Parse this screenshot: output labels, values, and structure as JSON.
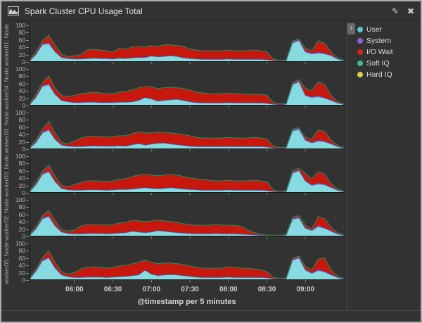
{
  "panel": {
    "title": "Spark Cluster CPU Usage Total",
    "edit_icon": "✎",
    "close_icon": "✖"
  },
  "legend": {
    "collapse_icon": "›",
    "items": [
      {
        "label": "User",
        "color": "#57c8d2"
      },
      {
        "label": "System",
        "color": "#8a63d2"
      },
      {
        "label": "I/O Wait",
        "color": "#d2251a"
      },
      {
        "label": "Soft IQ",
        "color": "#3cbf85"
      },
      {
        "label": "Hard IQ",
        "color": "#d6d33f"
      }
    ]
  },
  "axes": {
    "y_ticks": [
      100,
      80,
      60,
      40,
      20,
      0
    ],
    "x_ticks": [
      "06:00",
      "06:30",
      "07:00",
      "07:30",
      "08:00",
      "08:30",
      "09:00"
    ],
    "x_title": "@timestamp per 5 minutes"
  },
  "chart_data": {
    "type": "area",
    "stacked": true,
    "y_range": [
      0,
      100
    ],
    "grid": false,
    "legend_position": "right",
    "series_order": [
      "User",
      "System",
      "I/O Wait",
      "Soft IQ",
      "Hard IQ"
    ],
    "series_styles": {
      "User": {
        "fill": "#86dbe1",
        "stroke": "#2fa3ad"
      },
      "System": {
        "fill": "#8a5bd6",
        "stroke": "#6236b8"
      },
      "I/O Wait": {
        "fill": "#c8180e",
        "stroke": "#871410"
      },
      "Soft IQ": {
        "fill": "#3cb879",
        "stroke": "#2c8f5e"
      },
      "Hard IQ": {
        "fill": "#d6d33f",
        "stroke": "#a8a52e"
      }
    },
    "x": [
      "05:25",
      "05:30",
      "05:35",
      "05:40",
      "05:45",
      "05:50",
      "05:55",
      "06:00",
      "06:05",
      "06:10",
      "06:15",
      "06:20",
      "06:25",
      "06:30",
      "06:35",
      "06:40",
      "06:45",
      "06:50",
      "06:55",
      "07:00",
      "07:05",
      "07:10",
      "07:15",
      "07:20",
      "07:25",
      "07:30",
      "07:35",
      "07:40",
      "07:45",
      "07:50",
      "07:55",
      "08:00",
      "08:05",
      "08:10",
      "08:15",
      "08:20",
      "08:25",
      "08:30",
      "08:35",
      "08:40",
      "08:45",
      "08:50",
      "08:55",
      "09:00",
      "09:05",
      "09:10",
      "09:15",
      "09:20",
      "09:25",
      "09:30"
    ],
    "panels": [
      {
        "label": "worker01: Node",
        "series": {
          "User": [
            1,
            18,
            45,
            48,
            25,
            10,
            7,
            6,
            6,
            7,
            8,
            7,
            7,
            6,
            8,
            7,
            9,
            10,
            10,
            14,
            12,
            13,
            15,
            13,
            9,
            7,
            6,
            5,
            5,
            5,
            5,
            6,
            5,
            5,
            5,
            5,
            5,
            4,
            2,
            1,
            2,
            50,
            56,
            25,
            20,
            22,
            20,
            15,
            6,
            1
          ],
          "System": [
            0,
            2,
            3,
            3,
            2,
            1,
            1,
            1,
            1,
            1,
            1,
            1,
            1,
            1,
            1,
            1,
            1,
            1,
            1,
            1,
            1,
            1,
            1,
            1,
            1,
            1,
            1,
            1,
            1,
            1,
            1,
            1,
            1,
            1,
            1,
            1,
            1,
            1,
            0,
            0,
            0,
            2,
            3,
            2,
            2,
            3,
            2,
            2,
            1,
            0
          ],
          "I/O Wait": [
            1,
            5,
            7,
            19,
            15,
            7,
            4,
            7,
            11,
            22,
            23,
            22,
            20,
            18,
            26,
            24,
            28,
            29,
            27,
            27,
            27,
            30,
            28,
            28,
            30,
            24,
            23,
            22,
            22,
            22,
            22,
            23,
            22,
            22,
            22,
            24,
            22,
            20,
            3,
            1,
            1,
            3,
            1,
            8,
            6,
            30,
            26,
            8,
            1,
            1
          ],
          "Soft IQ": 0.6,
          "Hard IQ": 0
        }
      },
      {
        "label": "worker04: Node",
        "series": {
          "User": [
            1,
            20,
            50,
            55,
            28,
            12,
            8,
            6,
            6,
            7,
            7,
            6,
            6,
            6,
            7,
            7,
            8,
            12,
            20,
            16,
            10,
            12,
            14,
            15,
            12,
            8,
            6,
            5,
            5,
            5,
            5,
            6,
            5,
            5,
            5,
            5,
            5,
            4,
            2,
            1,
            2,
            55,
            63,
            25,
            20,
            22,
            18,
            12,
            5,
            1
          ],
          "System": [
            0,
            2,
            3,
            3,
            2,
            1,
            1,
            1,
            1,
            1,
            1,
            1,
            1,
            1,
            1,
            1,
            1,
            1,
            1,
            1,
            1,
            1,
            1,
            1,
            1,
            1,
            1,
            1,
            1,
            1,
            1,
            1,
            1,
            1,
            1,
            1,
            1,
            1,
            0,
            0,
            0,
            2,
            3,
            2,
            2,
            3,
            2,
            2,
            1,
            0
          ],
          "I/O Wait": [
            1,
            6,
            7,
            20,
            15,
            12,
            13,
            19,
            23,
            24,
            26,
            25,
            23,
            23,
            26,
            28,
            31,
            33,
            29,
            31,
            33,
            33,
            33,
            30,
            31,
            31,
            27,
            26,
            24,
            24,
            24,
            25,
            24,
            24,
            22,
            22,
            22,
            21,
            3,
            1,
            1,
            3,
            2,
            18,
            16,
            37,
            35,
            11,
            2,
            1
          ],
          "Soft IQ": 0.6,
          "Hard IQ": 0
        }
      },
      {
        "label": "worker03: Node",
        "series": {
          "User": [
            1,
            16,
            42,
            50,
            24,
            9,
            6,
            5,
            5,
            6,
            7,
            6,
            6,
            6,
            7,
            6,
            10,
            13,
            9,
            12,
            14,
            15,
            12,
            10,
            8,
            6,
            5,
            5,
            5,
            5,
            5,
            5,
            5,
            5,
            5,
            5,
            5,
            4,
            2,
            1,
            2,
            48,
            52,
            22,
            15,
            20,
            18,
            12,
            5,
            1
          ],
          "System": [
            0,
            2,
            3,
            3,
            2,
            1,
            1,
            1,
            1,
            1,
            1,
            1,
            1,
            1,
            1,
            1,
            1,
            1,
            1,
            1,
            1,
            1,
            1,
            1,
            1,
            1,
            1,
            1,
            1,
            1,
            1,
            1,
            1,
            1,
            1,
            1,
            1,
            1,
            0,
            0,
            0,
            2,
            3,
            2,
            2,
            3,
            2,
            2,
            1,
            0
          ],
          "I/O Wait": [
            1,
            4,
            7,
            20,
            14,
            6,
            5,
            14,
            22,
            25,
            25,
            25,
            23,
            25,
            26,
            27,
            29,
            31,
            32,
            29,
            29,
            27,
            29,
            29,
            29,
            27,
            24,
            22,
            22,
            22,
            22,
            24,
            22,
            22,
            22,
            24,
            22,
            21,
            3,
            1,
            1,
            2,
            1,
            6,
            8,
            27,
            26,
            8,
            2,
            1
          ],
          "Soft IQ": 0.6,
          "Hard IQ": 0
        }
      },
      {
        "label": "worker00: Node",
        "series": {
          "User": [
            1,
            20,
            48,
            55,
            28,
            10,
            6,
            5,
            5,
            6,
            6,
            6,
            5,
            6,
            7,
            7,
            8,
            10,
            12,
            10,
            9,
            10,
            12,
            10,
            8,
            7,
            6,
            5,
            5,
            5,
            5,
            6,
            5,
            5,
            5,
            5,
            5,
            4,
            2,
            1,
            2,
            52,
            58,
            30,
            18,
            22,
            20,
            12,
            5,
            1
          ],
          "System": [
            0,
            2,
            3,
            3,
            2,
            1,
            1,
            1,
            1,
            1,
            1,
            1,
            1,
            1,
            1,
            1,
            1,
            1,
            1,
            1,
            1,
            1,
            1,
            1,
            1,
            1,
            1,
            1,
            1,
            1,
            1,
            1,
            1,
            1,
            1,
            1,
            1,
            1,
            0,
            0,
            0,
            2,
            3,
            2,
            2,
            3,
            2,
            2,
            1,
            0
          ],
          "I/O Wait": [
            1,
            4,
            5,
            15,
            12,
            7,
            7,
            14,
            20,
            23,
            23,
            23,
            22,
            23,
            26,
            28,
            33,
            35,
            35,
            35,
            34,
            35,
            35,
            35,
            33,
            30,
            29,
            28,
            26,
            24,
            24,
            25,
            24,
            24,
            24,
            26,
            24,
            23,
            3,
            1,
            1,
            4,
            4,
            18,
            15,
            30,
            26,
            8,
            2,
            1
          ],
          "Soft IQ": 0.6,
          "Hard IQ": 0
        }
      },
      {
        "label": "worker02: Node",
        "series": {
          "User": [
            1,
            18,
            46,
            52,
            26,
            10,
            6,
            5,
            5,
            6,
            6,
            6,
            5,
            6,
            7,
            8,
            12,
            10,
            8,
            10,
            14,
            12,
            10,
            8,
            7,
            6,
            5,
            5,
            5,
            6,
            5,
            5,
            5,
            4,
            3,
            2,
            1,
            1,
            1,
            1,
            2,
            45,
            48,
            20,
            14,
            25,
            20,
            12,
            5,
            1
          ],
          "System": [
            0,
            2,
            3,
            3,
            2,
            1,
            1,
            1,
            1,
            1,
            1,
            1,
            1,
            1,
            1,
            1,
            1,
            1,
            1,
            1,
            1,
            1,
            1,
            1,
            1,
            1,
            1,
            1,
            1,
            1,
            1,
            1,
            1,
            1,
            1,
            1,
            1,
            0,
            0,
            0,
            0,
            2,
            3,
            2,
            2,
            3,
            2,
            2,
            1,
            0
          ],
          "I/O Wait": [
            1,
            4,
            5,
            13,
            12,
            5,
            5,
            8,
            20,
            23,
            23,
            23,
            22,
            23,
            26,
            27,
            29,
            29,
            29,
            29,
            27,
            27,
            27,
            27,
            24,
            23,
            22,
            22,
            22,
            23,
            22,
            22,
            22,
            20,
            11,
            5,
            1,
            0,
            0,
            0,
            1,
            3,
            3,
            6,
            2,
            24,
            24,
            8,
            2,
            1
          ],
          "Soft IQ": 0.6,
          "Hard IQ": 0
        }
      },
      {
        "label": "worker05: Node",
        "series": {
          "User": [
            1,
            22,
            50,
            58,
            30,
            12,
            7,
            5,
            5,
            6,
            6,
            6,
            5,
            6,
            7,
            8,
            10,
            12,
            25,
            14,
            10,
            12,
            13,
            12,
            10,
            8,
            6,
            5,
            5,
            5,
            5,
            6,
            5,
            5,
            5,
            5,
            5,
            4,
            2,
            1,
            2,
            52,
            58,
            25,
            16,
            24,
            20,
            12,
            5,
            1
          ],
          "System": [
            0,
            2,
            3,
            3,
            2,
            1,
            1,
            1,
            1,
            1,
            1,
            1,
            1,
            1,
            1,
            1,
            1,
            1,
            1,
            1,
            1,
            1,
            1,
            1,
            1,
            1,
            1,
            1,
            1,
            1,
            1,
            1,
            1,
            1,
            1,
            1,
            1,
            1,
            0,
            0,
            0,
            2,
            3,
            2,
            2,
            3,
            2,
            2,
            1,
            0
          ],
          "I/O Wait": [
            1,
            4,
            5,
            17,
            13,
            7,
            6,
            12,
            22,
            25,
            27,
            25,
            24,
            25,
            28,
            29,
            31,
            33,
            26,
            31,
            31,
            31,
            30,
            29,
            29,
            27,
            25,
            24,
            24,
            24,
            24,
            27,
            26,
            24,
            24,
            22,
            20,
            15,
            3,
            1,
            1,
            4,
            2,
            8,
            7,
            28,
            36,
            11,
            2,
            1
          ],
          "Soft IQ": 0.6,
          "Hard IQ": 0
        }
      }
    ]
  }
}
